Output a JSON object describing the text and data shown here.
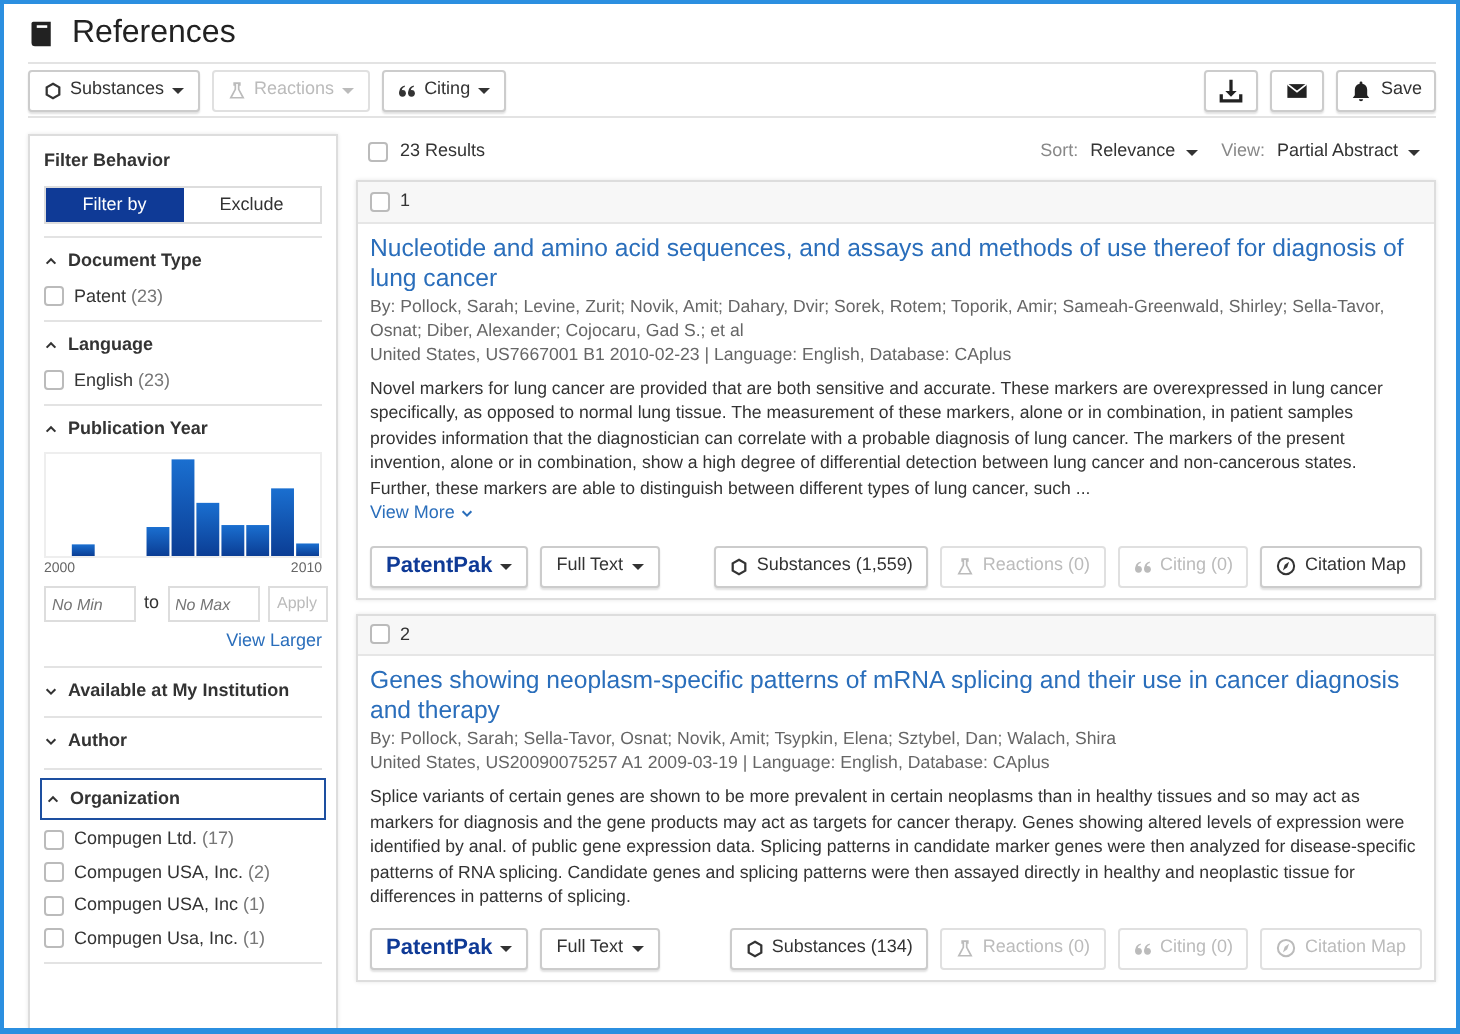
{
  "header": {
    "title": "References"
  },
  "toolbar": {
    "buttons": [
      {
        "kind": "substances",
        "label": "Substances",
        "disabled": false
      },
      {
        "kind": "reactions",
        "label": "Reactions",
        "disabled": true
      },
      {
        "kind": "citing",
        "label": "Citing",
        "disabled": false
      }
    ],
    "actions": [
      {
        "kind": "download"
      },
      {
        "kind": "email"
      },
      {
        "kind": "alert",
        "label": "Save"
      }
    ]
  },
  "filters": {
    "title": "Filter Behavior",
    "modes": [
      {
        "label": "Filter by",
        "selected": true
      },
      {
        "label": "Exclude",
        "selected": false
      }
    ],
    "sections": [
      {
        "kind": "options",
        "title": "Document Type",
        "expanded": true,
        "focused": false,
        "options": [
          {
            "label": "Patent",
            "count": "(23)",
            "checked": false
          }
        ]
      },
      {
        "kind": "options",
        "title": "Language",
        "expanded": true,
        "focused": false,
        "options": [
          {
            "label": "English",
            "count": "(23)",
            "checked": false
          }
        ]
      },
      {
        "kind": "histogram",
        "title": "Publication Year",
        "expanded": true,
        "focused": false,
        "axis_start": "2000",
        "axis_end": "2010",
        "min_placeholder": "No Min",
        "to": "to",
        "max_placeholder": "No Max",
        "apply": "Apply",
        "link": "View Larger"
      },
      {
        "title": "Available at My Institution",
        "expanded": false,
        "focused": false
      },
      {
        "title": "Author",
        "expanded": false,
        "focused": false
      },
      {
        "kind": "options",
        "title": "Organization",
        "expanded": true,
        "focused": true,
        "options": [
          {
            "label": "Compugen Ltd.",
            "count": "(17)",
            "checked": false
          },
          {
            "label": "Compugen USA, Inc.",
            "count": "(2)",
            "checked": false
          },
          {
            "label": "Compugen USA, Inc",
            "count": "(1)",
            "checked": false
          },
          {
            "label": "Compugen Usa, Inc.",
            "count": "(1)",
            "checked": false
          }
        ]
      }
    ]
  },
  "results": {
    "checked": false,
    "count": "23 Results",
    "sort_label": "Sort:",
    "sort": "Relevance",
    "view_label": "View:",
    "view": "Partial Abstract",
    "items": [
      {
        "checked": false,
        "number": "1",
        "title": "Nucleotide and amino acid sequences, and assays and methods of use thereof for diagnosis of lung cancer",
        "authors": "By: Pollock, Sarah; Levine, Zurit; Novik, Amit; Dahary, Dvir; Sorek, Rotem; Toporik, Amir; Sameah-Greenwald, Shirley; Sella-Tavor, Osnat; Diber, Alexander; Cojocaru, Gad S.; et al",
        "source": "United States, US7667001 B1 2010-02-23 | Language: English, Database: CAplus",
        "abstract": "Novel markers for lung cancer are provided that are both sensitive and accurate. These markers are overexpressed in lung cancer specifically, as opposed to normal lung tissue. The measurement of these markers, alone or in combination, in patient samples provides information that the diagnostician can correlate with a probable diagnosis of lung cancer. The markers of the present invention, alone or in combination, show a high degree of differential detection between lung cancer and non-cancerous states. Further, these markers are able to distinguish between different types of lung cancer, such ...",
        "view_more": "View More",
        "actions": [
          {
            "kind": "patentpak",
            "label": "PatentPak",
            "disabled": false
          },
          {
            "kind": "fulltext",
            "label": "Full Text",
            "disabled": false
          },
          {
            "kind": "substances",
            "label": "Substances (1,559)",
            "disabled": false
          },
          {
            "kind": "reactions",
            "label": "Reactions (0)",
            "disabled": true
          },
          {
            "kind": "citing",
            "label": "Citing (0)",
            "disabled": true
          },
          {
            "kind": "citationmap",
            "label": "Citation Map",
            "disabled": false
          }
        ]
      },
      {
        "checked": false,
        "number": "2",
        "title": "Genes showing neoplasm-specific patterns of mRNA splicing and their use in cancer diagnosis and therapy",
        "authors": "By: Pollock, Sarah; Sella-Tavor, Osnat; Novik, Amit; Tsypkin, Elena; Sztybel, Dan; Walach, Shira",
        "source": "United States, US20090075257 A1 2009-03-19 | Language: English, Database: CAplus",
        "abstract": "Splice variants of certain genes are shown to be more prevalent in certain neoplasms than in healthy tissues and so may act as markers for diagnosis and the gene products may act as targets for cancer therapy. Genes showing altered levels of expression were identified by anal. of public gene expression data. Splicing patterns in candidate marker genes were then analyzed for disease-specific patterns of RNA splicing. Candidate genes and splicing patterns were then assayed directly in healthy and neoplastic tissue for differences in patterns of splicing.",
        "actions": [
          {
            "kind": "patentpak",
            "label": "PatentPak",
            "disabled": false
          },
          {
            "kind": "fulltext",
            "label": "Full Text",
            "disabled": false
          },
          {
            "kind": "substances",
            "label": "Substances (134)",
            "disabled": false
          },
          {
            "kind": "reactions",
            "label": "Reactions (0)",
            "disabled": true
          },
          {
            "kind": "citing",
            "label": "Citing (0)",
            "disabled": true
          },
          {
            "kind": "citationmap",
            "label": "Citation Map",
            "disabled": true
          }
        ]
      }
    ]
  }
}
